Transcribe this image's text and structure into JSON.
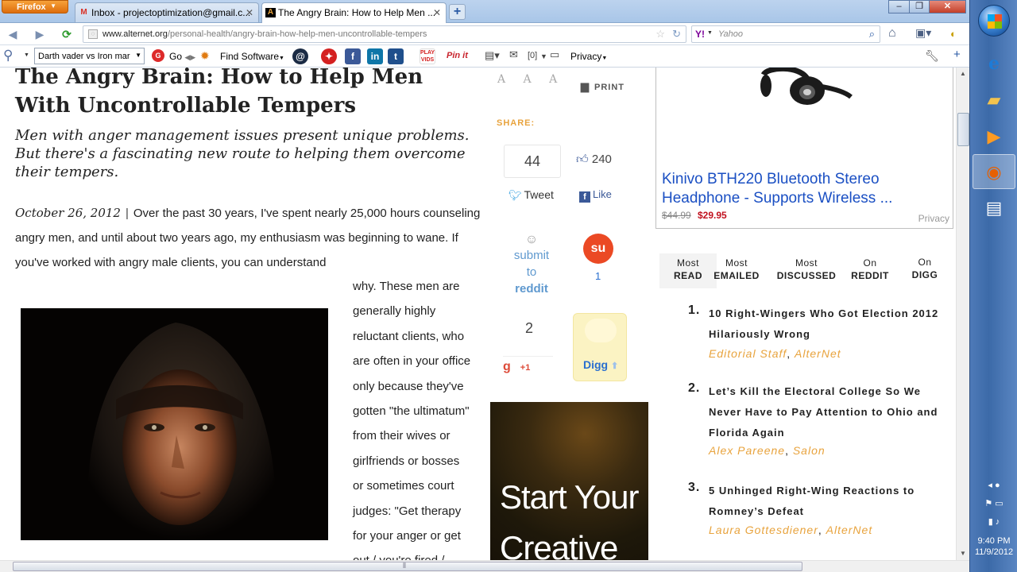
{
  "browser": {
    "menu_button": "Firefox",
    "tabs": [
      {
        "title": "Inbox - projectoptimization@gmail.c...",
        "icon": "gmail-icon",
        "active": false
      },
      {
        "title": "The Angry Brain: How to Help Men ...",
        "icon": "alternet-icon",
        "active": true
      }
    ],
    "url_domain": "www.alternet.org",
    "url_path": "/personal-health/angry-brain-how-help-men-uncontrollable-tempers",
    "search_engine": "Yahoo",
    "search_placeholder": "Yahoo"
  },
  "toolbar": {
    "search_value": "Darth vader vs Iron mar",
    "go_label": "Go",
    "find_software_label": "Find Software",
    "mail_count": "[0]",
    "privacy_label": "Privacy"
  },
  "article": {
    "headline": "The Angry Brain: How to Help Men With Uncontrollable Tempers",
    "dek": "Men with anger management issues present unique problems. But there's a fascinating new route to helping them overcome their tempers.",
    "date": "October 26, 2012",
    "separator": "|",
    "lead": "Over the past 30 years, I've spent nearly 25,000 hours counseling angry men, and until about two years ago, my enthusiasm was beginning to wane. If you've worked with angry male clients, you can understand",
    "wrapped_lines": [
      "why. These men are",
      "generally highly",
      "reluctant clients, who",
      "are often in your office",
      "only because they've",
      "gotten \"the ultimatum\"",
      "from their wives or",
      "girlfriends or bosses",
      "or sometimes court",
      "judges: \"Get therapy",
      "for your anger or get",
      "out / you're fired /"
    ]
  },
  "share": {
    "font_sizes": "A A A",
    "print_label": "PRINT",
    "share_heading": "SHARE:",
    "tweet_count": "44",
    "tweet_label": "Tweet",
    "fb_count": "240",
    "fb_like_label": "Like",
    "reddit_lines": [
      "submit",
      "to",
      "reddit"
    ],
    "stumble_count": "1",
    "gplus_count": "2",
    "gplus_label": "+1",
    "digg_label": "Digg"
  },
  "ads": {
    "headphone_title": "Kinivo BTH220 Bluetooth Stereo Headphone - Supports Wireless ...",
    "old_price": "$44.99",
    "new_price": "$29.95",
    "privacy": "Privacy",
    "start_line1": "Start Your",
    "start_line2": "Creative"
  },
  "most_tabs": [
    {
      "top": "Most",
      "bottom": "READ",
      "active": true
    },
    {
      "top": "Most",
      "bottom": "EMAILED",
      "active": false
    },
    {
      "top": "Most",
      "bottom": "DISCUSSED",
      "active": false
    },
    {
      "top": "On",
      "bottom": "REDDIT",
      "active": false
    },
    {
      "top": "On",
      "bottom": "DIGG",
      "active": false
    }
  ],
  "most_read": [
    {
      "num": "1.",
      "title": "10 Right-Wingers Who Got Election 2012 Hilariously Wrong",
      "author": "Editorial Staff",
      "source": "AlterNet"
    },
    {
      "num": "2.",
      "title": "Let’s Kill the Electoral College So We Never Have to Pay Attention to Ohio and Florida Again",
      "author": "Alex Pareene",
      "source": "Salon"
    },
    {
      "num": "3.",
      "title": "5 Unhinged Right-Wing Reactions to Romney’s Defeat",
      "author": "Laura Gottesdiener",
      "source": "AlterNet"
    }
  ],
  "taskbar": {
    "time": "9:40 PM",
    "date": "11/9/2012"
  },
  "colors": {
    "accent_orange": "#e8a33d",
    "link_blue": "#1a4fc3",
    "price_red": "#c1121f"
  }
}
